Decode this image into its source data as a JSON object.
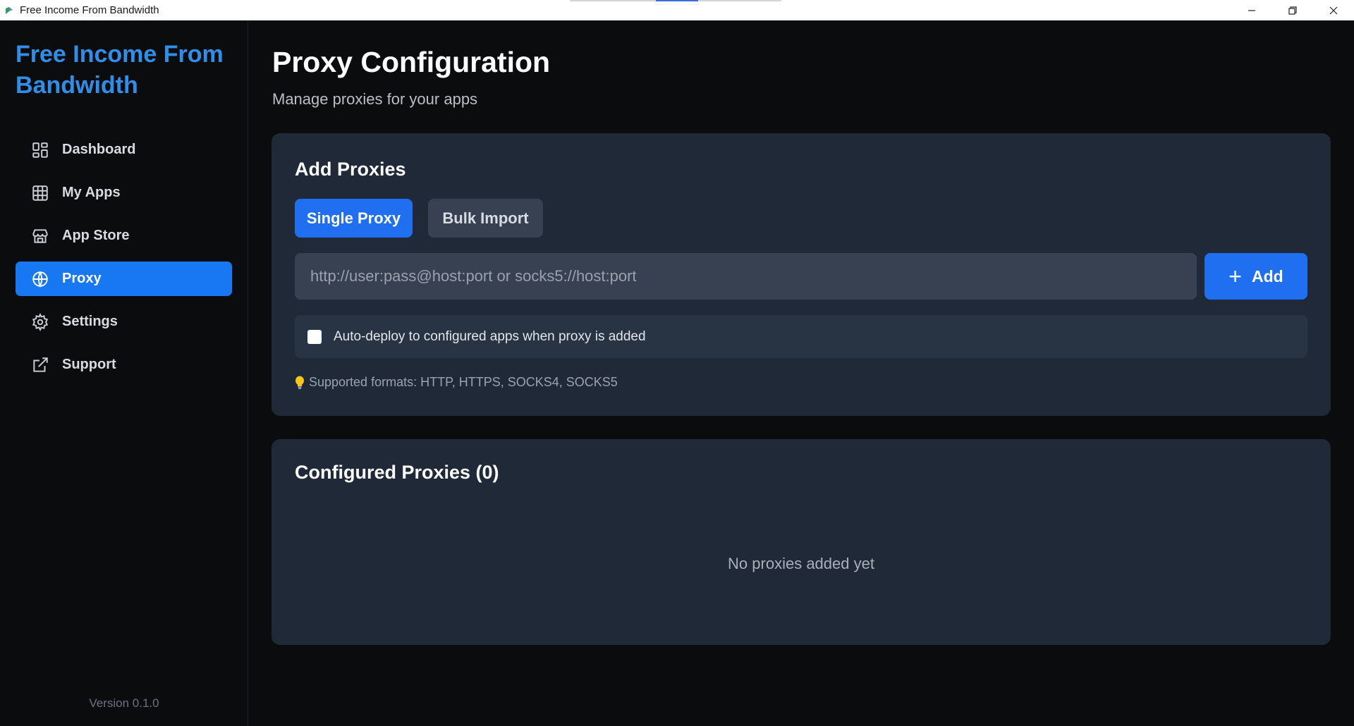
{
  "window": {
    "title": "Free Income From Bandwidth",
    "controls": [
      "minimize",
      "restore",
      "close"
    ]
  },
  "sidebar": {
    "brand": "Free Income From Bandwidth",
    "items": [
      {
        "label": "Dashboard",
        "icon": "dashboard-icon",
        "active": false
      },
      {
        "label": "My Apps",
        "icon": "grid-icon",
        "active": false
      },
      {
        "label": "App Store",
        "icon": "store-icon",
        "active": false
      },
      {
        "label": "Proxy",
        "icon": "globe-icon",
        "active": true
      },
      {
        "label": "Settings",
        "icon": "gear-icon",
        "active": false
      },
      {
        "label": "Support",
        "icon": "external-link-icon",
        "active": false
      }
    ],
    "version": "Version 0.1.0"
  },
  "main": {
    "title": "Proxy Configuration",
    "subtitle": "Manage proxies for your apps",
    "add_card": {
      "title": "Add Proxies",
      "tabs": [
        {
          "label": "Single Proxy",
          "active": true
        },
        {
          "label": "Bulk Import",
          "active": false
        }
      ],
      "input": {
        "value": "",
        "placeholder": "http://user:pass@host:port or socks5://host:port"
      },
      "add_button": "Add",
      "autodeploy_label": "Auto-deploy to configured apps when proxy is added",
      "autodeploy_checked": false,
      "hint": "Supported formats: HTTP, HTTPS, SOCKS4, SOCKS5"
    },
    "list_card": {
      "title": "Configured Proxies (0)",
      "empty_message": "No proxies added yet"
    }
  },
  "colors": {
    "accent": "#1f6ff0",
    "brand": "#2f8fe8",
    "card_bg": "#1f2937",
    "page_bg": "#0b0c0e"
  }
}
